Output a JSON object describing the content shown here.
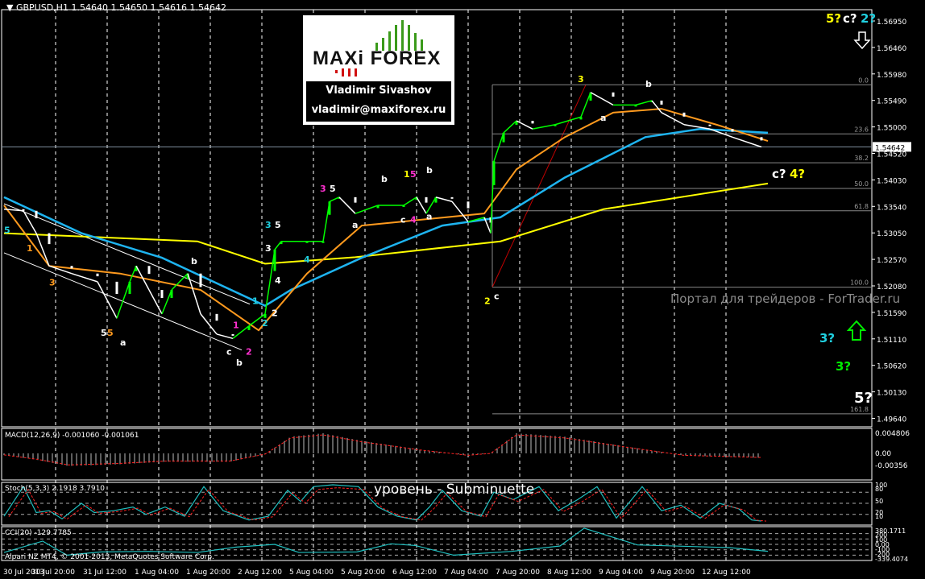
{
  "header": {
    "symbol": "GBPUSD,H1",
    "open": "1.54640",
    "high": "1.54650",
    "low": "1.54616",
    "close": "1.54642"
  },
  "logo": {
    "brand": "MAXi FOREX",
    "author": "Vladimir Sivashov",
    "email": "vladimir@maxiforex.ru"
  },
  "watermark": "Портал для трейдеров - ForTrader.ru",
  "level_text": "уровень - Subminuette",
  "copyright": "Alpari NZ MT4, © 2001-2013, MetaQuotes Software Corp.",
  "indicators": {
    "macd_title": "MACD(12,26,9) -0.001060 -0.001061",
    "stoch_title": "Stoch(5,3,3) 2.1918 3.7910",
    "cci_title": "CCI(20) -129.7785"
  },
  "colors": {
    "bg": "#000000",
    "price": "#ffffff",
    "bull": "#00ff00",
    "ma_yellow": "#ffff00",
    "ma_blue": "#1eb4f0",
    "ma_orange": "#ff9a1e",
    "ma_magenta": "#ff30d0",
    "stoch": "#20c0c0",
    "signal": "#ff2020"
  },
  "chart_data": {
    "type": "line",
    "title": "GBPUSD,H1",
    "ylim": [
      1.4964,
      1.5695
    ],
    "current_price": "1.54642",
    "price_ticks": [
      "1.56950",
      "1.56460",
      "1.55980",
      "1.55490",
      "1.55000",
      "1.54520",
      "1.54030",
      "1.53540",
      "1.53050",
      "1.52570",
      "1.52080",
      "1.51590",
      "1.51110",
      "1.50620",
      "1.50130",
      "1.49640"
    ],
    "time_ticks": [
      "30 Jul 2013",
      "30 Jul 20:00",
      "31 Jul 12:00",
      "1 Aug 04:00",
      "1 Aug 20:00",
      "2 Aug 12:00",
      "5 Aug 04:00",
      "5 Aug 20:00",
      "6 Aug 12:00",
      "7 Aug 04:00",
      "7 Aug 20:00",
      "8 Aug 12:00",
      "9 Aug 04:00",
      "9 Aug 20:00",
      "12 Aug 12:00"
    ],
    "bars_per_tick": 16,
    "price": [
      [
        0,
        1.535
      ],
      [
        6,
        1.5347
      ],
      [
        10,
        1.5306
      ],
      [
        14,
        1.5246
      ],
      [
        21,
        1.5232
      ],
      [
        29,
        1.5217
      ],
      [
        35,
        1.515
      ],
      [
        39,
        1.5217
      ],
      [
        41,
        1.5246
      ],
      [
        45,
        1.5202
      ],
      [
        49,
        1.5158
      ],
      [
        52,
        1.5202
      ],
      [
        57,
        1.5232
      ],
      [
        61,
        1.5158
      ],
      [
        66,
        1.5121
      ],
      [
        71,
        1.5113
      ],
      [
        76,
        1.5136
      ],
      [
        81,
        1.5158
      ],
      [
        84,
        1.5276
      ],
      [
        86,
        1.5291
      ],
      [
        94,
        1.5291
      ],
      [
        99,
        1.5291
      ],
      [
        101,
        1.5364
      ],
      [
        104,
        1.5372
      ],
      [
        109,
        1.5342
      ],
      [
        116,
        1.5357
      ],
      [
        124,
        1.5357
      ],
      [
        128,
        1.5372
      ],
      [
        131,
        1.5342
      ],
      [
        134,
        1.5372
      ],
      [
        139,
        1.5364
      ],
      [
        144,
        1.5327
      ],
      [
        149,
        1.5335
      ],
      [
        151,
        1.5306
      ],
      [
        152,
        1.5438
      ],
      [
        155,
        1.549
      ],
      [
        159,
        1.5512
      ],
      [
        164,
        1.5497
      ],
      [
        171,
        1.5505
      ],
      [
        179,
        1.5519
      ],
      [
        182,
        1.5564
      ],
      [
        189,
        1.5541
      ],
      [
        196,
        1.5541
      ],
      [
        201,
        1.5549
      ],
      [
        204,
        1.5527
      ],
      [
        211,
        1.5505
      ],
      [
        219,
        1.5497
      ],
      [
        226,
        1.5482
      ],
      [
        235,
        1.5464
      ]
    ],
    "ma_yellow": [
      [
        0,
        1.5306
      ],
      [
        60,
        1.5291
      ],
      [
        81,
        1.525
      ],
      [
        109,
        1.5262
      ],
      [
        154,
        1.5291
      ],
      [
        186,
        1.535
      ],
      [
        237,
        1.5397
      ]
    ],
    "ma_blue": [
      [
        0,
        1.5372
      ],
      [
        24,
        1.5306
      ],
      [
        49,
        1.5261
      ],
      [
        81,
        1.5173
      ],
      [
        89,
        1.5202
      ],
      [
        111,
        1.5261
      ],
      [
        136,
        1.532
      ],
      [
        154,
        1.5335
      ],
      [
        174,
        1.5408
      ],
      [
        199,
        1.5482
      ],
      [
        216,
        1.5497
      ],
      [
        237,
        1.549
      ]
    ],
    "ma_orange": [
      [
        0,
        1.5357
      ],
      [
        14,
        1.5246
      ],
      [
        36,
        1.5232
      ],
      [
        61,
        1.5202
      ],
      [
        79,
        1.5128
      ],
      [
        94,
        1.5232
      ],
      [
        111,
        1.532
      ],
      [
        149,
        1.5342
      ],
      [
        159,
        1.5423
      ],
      [
        174,
        1.5482
      ],
      [
        189,
        1.5527
      ],
      [
        204,
        1.5534
      ],
      [
        221,
        1.5505
      ],
      [
        237,
        1.5475
      ]
    ],
    "fib_levels": [
      {
        "label": "0.0",
        "price": 1.5578
      },
      {
        "label": "23.6",
        "price": 1.5488
      },
      {
        "label": "38.2",
        "price": 1.5435
      },
      {
        "label": "50.0",
        "price": 1.5388
      },
      {
        "label": "61.8",
        "price": 1.5347
      },
      {
        "label": "100.0",
        "price": 1.5207
      },
      {
        "label": "161.8",
        "price": 1.4975
      }
    ],
    "wave_labels": [
      {
        "t": "5",
        "bar": 0,
        "p": 1.5306,
        "c": "#20d0e0"
      },
      {
        "t": "1",
        "bar": 7,
        "p": 1.5273,
        "c": "#ff9a1e"
      },
      {
        "t": "3",
        "bar": 14,
        "p": 1.521,
        "c": "#ff9a1e"
      },
      {
        "t": "5",
        "bar": 30,
        "p": 1.5118,
        "c": "#ffffff"
      },
      {
        "t": "5",
        "bar": 32,
        "p": 1.5118,
        "c": "#ff9a1e"
      },
      {
        "t": "a",
        "bar": 36,
        "p": 1.51,
        "c": "#ffffff"
      },
      {
        "t": "b",
        "bar": 58,
        "p": 1.5249,
        "c": "#ffffff"
      },
      {
        "t": "1",
        "bar": 71,
        "p": 1.5132,
        "c": "#ff30d0"
      },
      {
        "t": "c",
        "bar": 69,
        "p": 1.5083,
        "c": "#ffffff"
      },
      {
        "t": "b",
        "bar": 72,
        "p": 1.5063,
        "c": "#ffffff"
      },
      {
        "t": "2",
        "bar": 75,
        "p": 1.5083,
        "c": "#ff30d0"
      },
      {
        "t": "1",
        "bar": 77,
        "p": 1.5176,
        "c": "#20d0e0"
      },
      {
        "t": "2",
        "bar": 80,
        "p": 1.5136,
        "c": "#20d0e0"
      },
      {
        "t": "2",
        "bar": 83,
        "p": 1.5154,
        "c": "#ffffff"
      },
      {
        "t": "3",
        "bar": 81,
        "p": 1.5273,
        "c": "#ffffff"
      },
      {
        "t": "4",
        "bar": 84,
        "p": 1.5214,
        "c": "#ffffff"
      },
      {
        "t": "3",
        "bar": 81,
        "p": 1.5316,
        "c": "#20d0e0"
      },
      {
        "t": "5",
        "bar": 84,
        "p": 1.5316,
        "c": "#ffffff"
      },
      {
        "t": "4",
        "bar": 93,
        "p": 1.5252,
        "c": "#20d0e0"
      },
      {
        "t": "3",
        "bar": 98,
        "p": 1.5382,
        "c": "#ff30d0"
      },
      {
        "t": "5",
        "bar": 101,
        "p": 1.5382,
        "c": "#ffffff"
      },
      {
        "t": "a",
        "bar": 108,
        "p": 1.5316,
        "c": "#ffffff"
      },
      {
        "t": "b",
        "bar": 117,
        "p": 1.54,
        "c": "#ffffff"
      },
      {
        "t": "c",
        "bar": 123,
        "p": 1.5325,
        "c": "#ffffff"
      },
      {
        "t": "4",
        "bar": 126,
        "p": 1.5325,
        "c": "#ff30d0"
      },
      {
        "t": "a",
        "bar": 131,
        "p": 1.5331,
        "c": "#ffffff"
      },
      {
        "t": "1",
        "bar": 124,
        "p": 1.5409,
        "c": "#ffff00"
      },
      {
        "t": "5",
        "bar": 126,
        "p": 1.5409,
        "c": "#ff30d0"
      },
      {
        "t": "b",
        "bar": 131,
        "p": 1.5416,
        "c": "#ffffff"
      },
      {
        "t": "2",
        "bar": 149,
        "p": 1.5176,
        "c": "#ffff00"
      },
      {
        "t": "c",
        "bar": 152,
        "p": 1.5185,
        "c": "#ffffff"
      },
      {
        "t": "3",
        "bar": 178,
        "p": 1.5583,
        "c": "#ffff00"
      },
      {
        "t": "b",
        "bar": 199,
        "p": 1.5574,
        "c": "#ffffff"
      },
      {
        "t": "a",
        "bar": 185,
        "p": 1.5512,
        "c": "#ffffff"
      }
    ],
    "forecast_labels": [
      {
        "t": "5?",
        "c": "#ffff00",
        "pos": "top-right-1"
      },
      {
        "t": "c?",
        "c": "#ffffff",
        "pos": "top-right-2"
      },
      {
        "t": "2?",
        "c": "#20d0e0",
        "pos": "top-right-3"
      },
      {
        "t": "c?",
        "c": "#ffffff",
        "pos": "mid-1"
      },
      {
        "t": "4?",
        "c": "#ffff00",
        "pos": "mid-2"
      },
      {
        "t": "3?",
        "c": "#20d0e0",
        "pos": "low-1"
      },
      {
        "t": "3?",
        "c": "#00ee00",
        "pos": "low-2"
      },
      {
        "t": "5?",
        "c": "#ffffff",
        "pos": "low-3"
      }
    ],
    "macd": {
      "ticks": [
        "0.004806",
        "0.00",
        "-0.00356"
      ],
      "hist": [
        [
          0,
          -0.0004
        ],
        [
          10,
          -0.0015
        ],
        [
          20,
          -0.003
        ],
        [
          36,
          -0.0026
        ],
        [
          50,
          -0.002
        ],
        [
          70,
          -0.002
        ],
        [
          81,
          -0.0002
        ],
        [
          89,
          0.004
        ],
        [
          99,
          0.0048
        ],
        [
          111,
          0.003
        ],
        [
          129,
          0.0009
        ],
        [
          144,
          -0.0005
        ],
        [
          151,
          0.0
        ],
        [
          159,
          0.0048
        ],
        [
          174,
          0.004
        ],
        [
          194,
          0.0015
        ],
        [
          211,
          -0.0005
        ],
        [
          235,
          -0.00106
        ]
      ]
    },
    "stoch": {
      "ticks": [
        "100",
        "80",
        "50",
        "20",
        "10"
      ],
      "main": [
        [
          0,
          15
        ],
        [
          6,
          95
        ],
        [
          10,
          25
        ],
        [
          14,
          30
        ],
        [
          18,
          8
        ],
        [
          24,
          50
        ],
        [
          28,
          25
        ],
        [
          34,
          30
        ],
        [
          40,
          40
        ],
        [
          44,
          20
        ],
        [
          50,
          40
        ],
        [
          56,
          15
        ],
        [
          62,
          95
        ],
        [
          68,
          30
        ],
        [
          76,
          5
        ],
        [
          82,
          15
        ],
        [
          88,
          85
        ],
        [
          92,
          55
        ],
        [
          96,
          95
        ],
        [
          102,
          100
        ],
        [
          110,
          95
        ],
        [
          116,
          40
        ],
        [
          122,
          15
        ],
        [
          128,
          5
        ],
        [
          132,
          40
        ],
        [
          136,
          85
        ],
        [
          142,
          30
        ],
        [
          148,
          15
        ],
        [
          152,
          80
        ],
        [
          158,
          60
        ],
        [
          166,
          95
        ],
        [
          172,
          30
        ],
        [
          178,
          60
        ],
        [
          184,
          95
        ],
        [
          190,
          10
        ],
        [
          198,
          95
        ],
        [
          204,
          30
        ],
        [
          210,
          45
        ],
        [
          216,
          10
        ],
        [
          222,
          50
        ],
        [
          228,
          35
        ],
        [
          232,
          5
        ],
        [
          235,
          2
        ]
      ]
    },
    "cci": {
      "ticks": [
        "380.1711",
        "200",
        "100",
        "0.00",
        "-100",
        "-200",
        "-339.4074"
      ],
      "main": [
        [
          0,
          -150
        ],
        [
          16,
          60
        ],
        [
          26,
          -200
        ],
        [
          40,
          -140
        ],
        [
          60,
          -130
        ],
        [
          80,
          -150
        ],
        [
          96,
          -50
        ],
        [
          112,
          0
        ],
        [
          122,
          -150
        ],
        [
          146,
          -140
        ],
        [
          160,
          10
        ],
        [
          170,
          -20
        ],
        [
          186,
          -200
        ],
        [
          210,
          -130
        ],
        [
          230,
          -30
        ],
        [
          240,
          300
        ],
        [
          262,
          -10
        ],
        [
          300,
          -60
        ],
        [
          316,
          -129
        ]
      ]
    }
  }
}
